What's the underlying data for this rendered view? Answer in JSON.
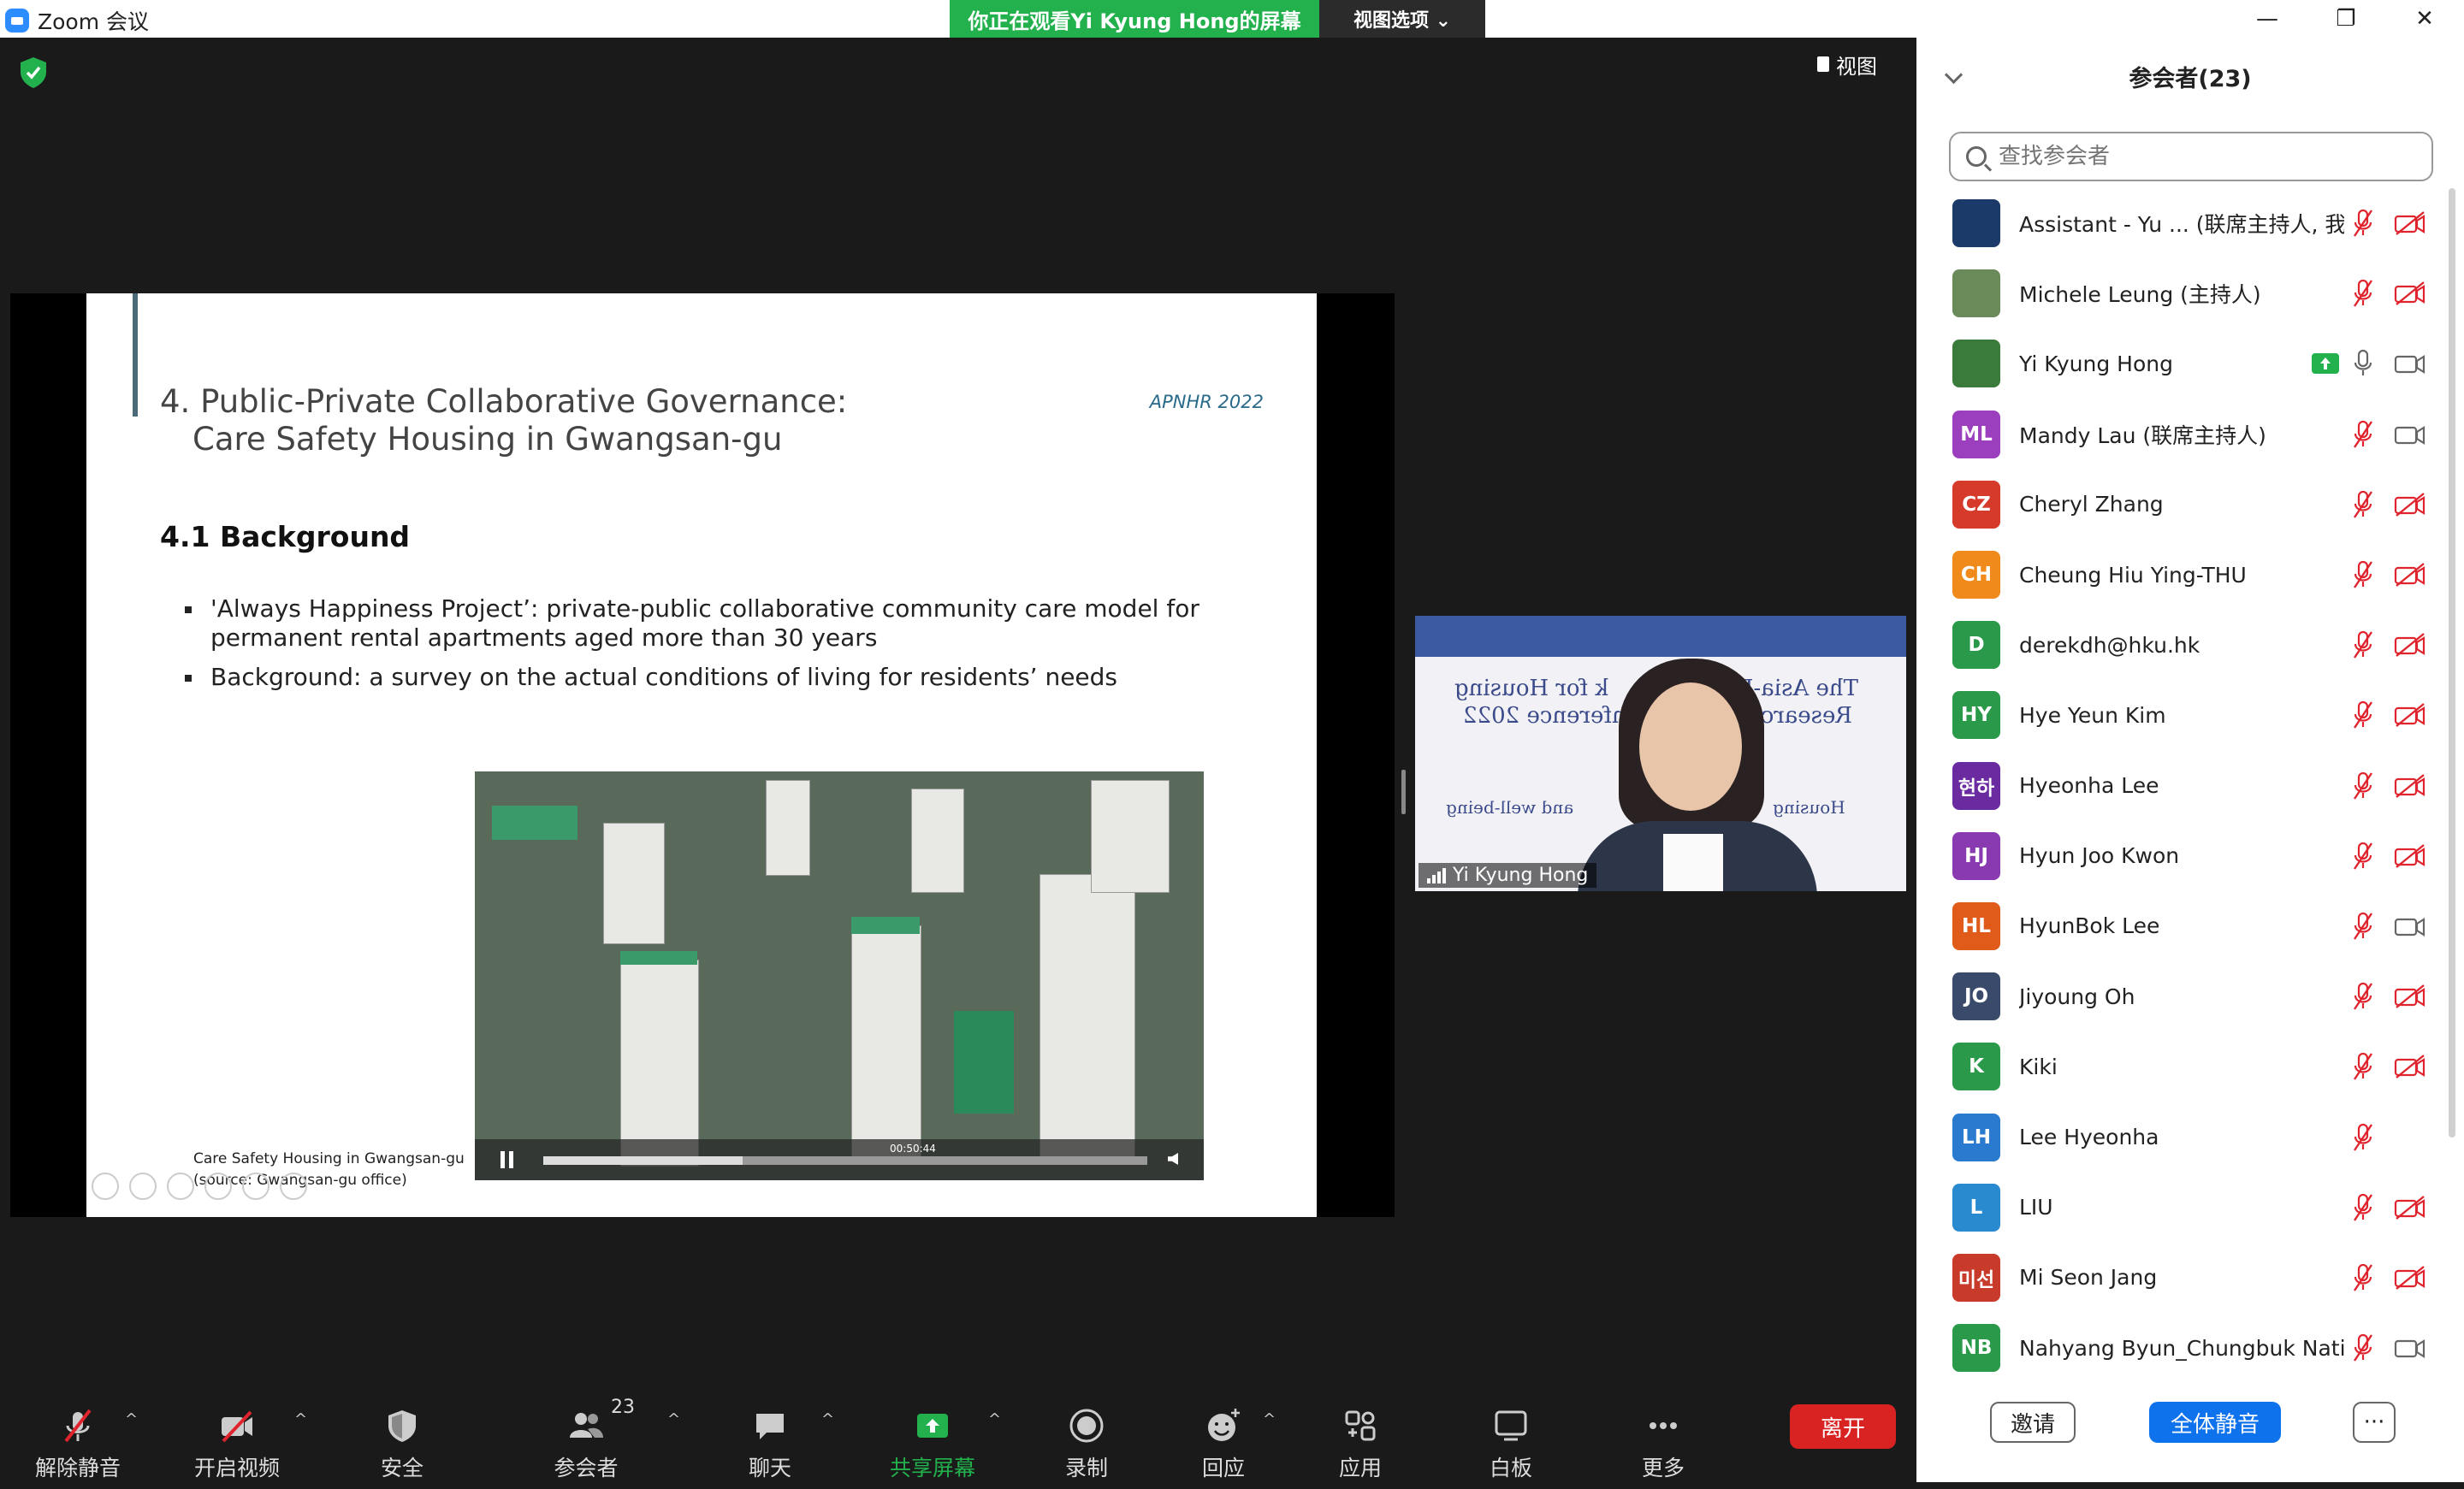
{
  "titlebar": {
    "app_title": "Zoom 会议",
    "minimize": "—",
    "restore": "❐",
    "close": "✕"
  },
  "share_banner": {
    "text": "你正在观看Yi Kyung Hong的屏幕",
    "options": "视图选项 ⌄"
  },
  "view_button": "视图",
  "slide": {
    "title_line1": "4. Public-Private Collaborative Governance:",
    "title_line2": "Care Safety Housing in Gwangsan-gu",
    "tag": "APNHR 2022",
    "subtitle": "4.1 Background",
    "bullets": [
      "'Always Happiness Project’: private-public collaborative community care model for permanent rental apartments aged more than 30 years",
      "Background: a survey on the actual conditions of living for residents’ needs"
    ],
    "video_time": "00:50:44",
    "video_progress": 0.33,
    "caption_line1": "Care Safety Housing in Gwangsan-gu",
    "caption_line2": "(source: Gwangsan-gu office)"
  },
  "speaker": {
    "name": "Yi Kyung Hong",
    "bg_text_1": "The Asia-P",
    "bg_text_2": "k for Housing",
    "bg_text_3": "Research",
    "bg_text_4": "nference 2022",
    "bg_text_5": "Housing",
    "bg_text_6": "and well-being"
  },
  "toolbar": {
    "unmute": "解除静音",
    "start_video": "开启视频",
    "security": "安全",
    "participants": "参会者",
    "participants_count": "23",
    "chat": "聊天",
    "share_screen": "共享屏幕",
    "record": "录制",
    "reactions": "回应",
    "apps": "应用",
    "whiteboard": "白板",
    "more": "更多",
    "leave": "离开"
  },
  "panel": {
    "title": "参会者(23)",
    "search_placeholder": "查找参会者",
    "invite": "邀请",
    "mute_all": "全体静音",
    "more": "···",
    "participants": [
      {
        "initials": "",
        "name": "Assistant - Yu ... (联席主持人, 我)",
        "color": "#1b3a6a",
        "mic": "muted",
        "cam": "off"
      },
      {
        "initials": "",
        "name": "Michele Leung (主持人)",
        "color": "#6a8a5a",
        "mic": "muted",
        "cam": "off"
      },
      {
        "initials": "",
        "name": "Yi Kyung Hong",
        "color": "#3a7a3a",
        "mic": "on",
        "cam": "on",
        "sharing": true
      },
      {
        "initials": "ML",
        "name": "Mandy Lau (联席主持人)",
        "color": "#9b3fbf",
        "mic": "muted",
        "cam": "on"
      },
      {
        "initials": "CZ",
        "name": "Cheryl Zhang",
        "color": "#d63a2a",
        "mic": "muted",
        "cam": "off"
      },
      {
        "initials": "CH",
        "name": "Cheung Hiu Ying-THU",
        "color": "#f08a1a",
        "mic": "muted",
        "cam": "off"
      },
      {
        "initials": "D",
        "name": "derekdh@hku.hk",
        "color": "#2a9a4a",
        "mic": "muted",
        "cam": "off"
      },
      {
        "initials": "HY",
        "name": "Hye Yeun Kim",
        "color": "#2a9a4a",
        "mic": "muted",
        "cam": "off"
      },
      {
        "initials": "현하",
        "name": "Hyeonha Lee",
        "color": "#6a2aa0",
        "mic": "muted",
        "cam": "off"
      },
      {
        "initials": "HJ",
        "name": "Hyun Joo Kwon",
        "color": "#8a3ab0",
        "mic": "muted",
        "cam": "off"
      },
      {
        "initials": "HL",
        "name": "HyunBok Lee",
        "color": "#e05a1a",
        "mic": "muted",
        "cam": "on"
      },
      {
        "initials": "JO",
        "name": "Jiyoung Oh",
        "color": "#3a4a6a",
        "mic": "muted",
        "cam": "off"
      },
      {
        "initials": "K",
        "name": "Kiki",
        "color": "#2a9a4a",
        "mic": "muted",
        "cam": "off"
      },
      {
        "initials": "LH",
        "name": "Lee Hyeonha",
        "color": "#2a7ad0",
        "mic": "muted",
        "cam": "none"
      },
      {
        "initials": "L",
        "name": "LIU",
        "color": "#2a8ad0",
        "mic": "muted",
        "cam": "off"
      },
      {
        "initials": "미선",
        "name": "Mi Seon Jang",
        "color": "#c83a2a",
        "mic": "muted",
        "cam": "off"
      },
      {
        "initials": "NB",
        "name": "Nahyang Byun_Chungbuk Nati...",
        "color": "#2a9a4a",
        "mic": "muted",
        "cam": "on"
      }
    ]
  },
  "colors": {
    "zoom_blue": "#2d8cff",
    "green": "#23b14d",
    "red": "#d92323",
    "mute_red": "#e0242e"
  }
}
